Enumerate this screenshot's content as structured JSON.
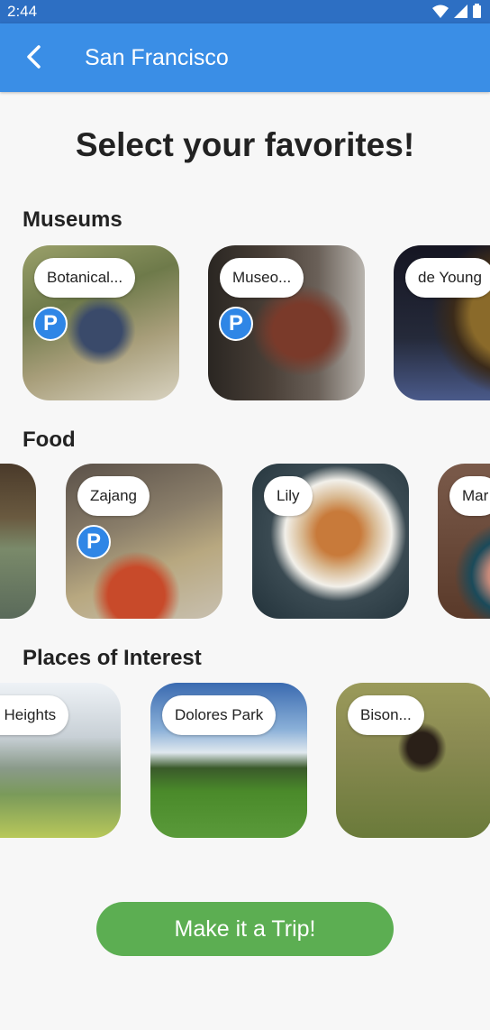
{
  "status_bar": {
    "time": "2:44"
  },
  "app_bar": {
    "title": "San Francisco"
  },
  "heading": "Select your favorites!",
  "sections": [
    {
      "title": "Museums",
      "cards": [
        {
          "label": "Botanical...",
          "parking": true,
          "photo": "botanical-garden-plants"
        },
        {
          "label": "Museo...",
          "parking": true,
          "photo": "museum-costume-exhibit"
        },
        {
          "label": "de Young",
          "parking": false,
          "photo": "de-young-gold-artifact"
        }
      ]
    },
    {
      "title": "Food",
      "cards": [
        {
          "label": "",
          "parking": false,
          "photo": "restaurant-interior"
        },
        {
          "label": "Zajang",
          "parking": true,
          "photo": "korean-bbq-grill"
        },
        {
          "label": "Lily",
          "parking": false,
          "photo": "salad-plate"
        },
        {
          "label": "Mar",
          "parking": false,
          "photo": "food-bowls"
        }
      ]
    },
    {
      "title": "Places of Interest",
      "cards": [
        {
          "label": "ernal Heights",
          "parking": false,
          "photo": "bernal-heights-view"
        },
        {
          "label": "Dolores Park",
          "parking": false,
          "photo": "dolores-park-lawn"
        },
        {
          "label": "Bison...",
          "parking": false,
          "photo": "bison-field"
        }
      ]
    }
  ],
  "parking_badge": "P",
  "trip_button": "Make it a Trip!",
  "colors": {
    "status_bar": "#2d6fc3",
    "app_bar": "#3a8ee6",
    "button": "#5cae52",
    "badge": "#2f86e6"
  }
}
